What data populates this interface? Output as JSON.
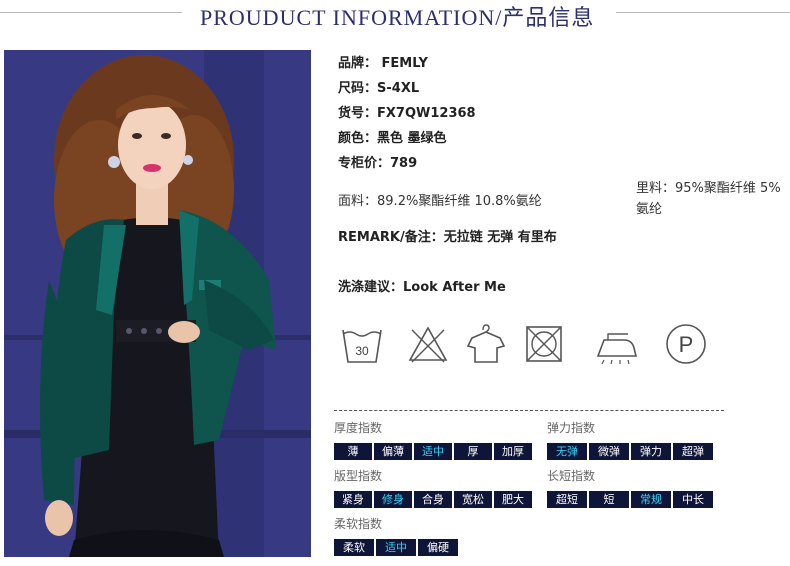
{
  "header": {
    "title": "PROUDUCT INFORMATION/产品信息"
  },
  "product": {
    "brand_label": "品牌：",
    "brand": "FEMLY",
    "size_label": "尺码：",
    "size": "S-4XL",
    "sku_label": "货号：",
    "sku": "FX7QW12368",
    "color_label": "颜色：",
    "color": "黑色 墨绿色",
    "price_label": "专柜价：",
    "price": "789",
    "fabric_label": "面料：",
    "fabric": "89.2%聚酯纤维 10.8%氨纶",
    "lining_label": "里料：",
    "lining": "95%聚酯纤维 5%氨纶",
    "remark_label": "REMARK/备注：",
    "remark": "无拉链 无弹 有里布",
    "wash_label": "洗涤建议：",
    "wash": "Look After Me"
  },
  "care_icons": {
    "wash_temp": "30"
  },
  "indices": {
    "thickness": {
      "label": "厚度指数",
      "options": [
        "薄",
        "偏薄",
        "适中",
        "厚",
        "加厚"
      ],
      "selected": "适中"
    },
    "elasticity": {
      "label": "弹力指数",
      "options": [
        "无弹",
        "微弹",
        "弹力",
        "超弹"
      ],
      "selected": "无弹"
    },
    "fit": {
      "label": "版型指数",
      "options": [
        "紧身",
        "修身",
        "合身",
        "宽松",
        "肥大"
      ],
      "selected": "修身"
    },
    "length": {
      "label": "长短指数",
      "options": [
        "超短",
        "短",
        "常规",
        "中长"
      ],
      "selected": "常规"
    },
    "softness": {
      "label": "柔软指数",
      "options": [
        "柔软",
        "适中",
        "偏硬"
      ],
      "selected": "适中"
    }
  },
  "colors": {
    "accent": "#35d3f6",
    "tag_bg": "#0f1538",
    "title": "#2c2f6e"
  }
}
